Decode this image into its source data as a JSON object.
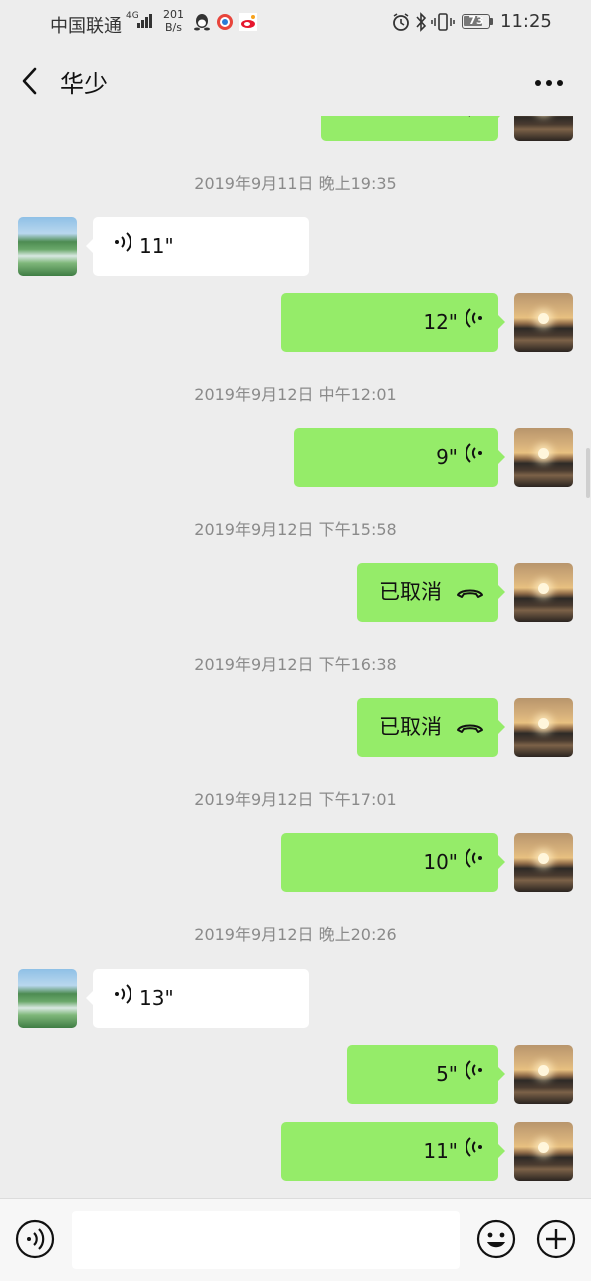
{
  "status_bar": {
    "carrier": "中国联通",
    "network": "4G",
    "speed_value": "201",
    "speed_unit": "B/s",
    "battery": "73",
    "time": "11:25"
  },
  "header": {
    "title": "华少"
  },
  "messages": [
    {
      "kind": "time",
      "text": "2019年9月11日 晚上19:35"
    },
    {
      "kind": "voice",
      "from": "other",
      "text": "11\""
    },
    {
      "kind": "voice",
      "from": "me",
      "text": "12\""
    },
    {
      "kind": "time",
      "text": "2019年9月12日 中午12:01"
    },
    {
      "kind": "voice",
      "from": "me",
      "text": "9\""
    },
    {
      "kind": "time",
      "text": "2019年9月12日 下午15:58"
    },
    {
      "kind": "call",
      "from": "me",
      "text": "已取消"
    },
    {
      "kind": "time",
      "text": "2019年9月12日 下午16:38"
    },
    {
      "kind": "call",
      "from": "me",
      "text": "已取消"
    },
    {
      "kind": "time",
      "text": "2019年9月12日 下午17:01"
    },
    {
      "kind": "voice",
      "from": "me",
      "text": "10\""
    },
    {
      "kind": "time",
      "text": "2019年9月12日 晚上20:26"
    },
    {
      "kind": "voice",
      "from": "other",
      "text": "13\""
    },
    {
      "kind": "voice",
      "from": "me",
      "text": "5\""
    },
    {
      "kind": "voice",
      "from": "me",
      "text": "11\""
    }
  ],
  "bottom_bar": {
    "input_value": "",
    "icons": [
      "voice-toggle-icon",
      "emoji-icon",
      "plus-icon"
    ]
  },
  "colors": {
    "my_bubble": "#95ec69",
    "other_bubble": "#ffffff",
    "background": "#ededed"
  }
}
